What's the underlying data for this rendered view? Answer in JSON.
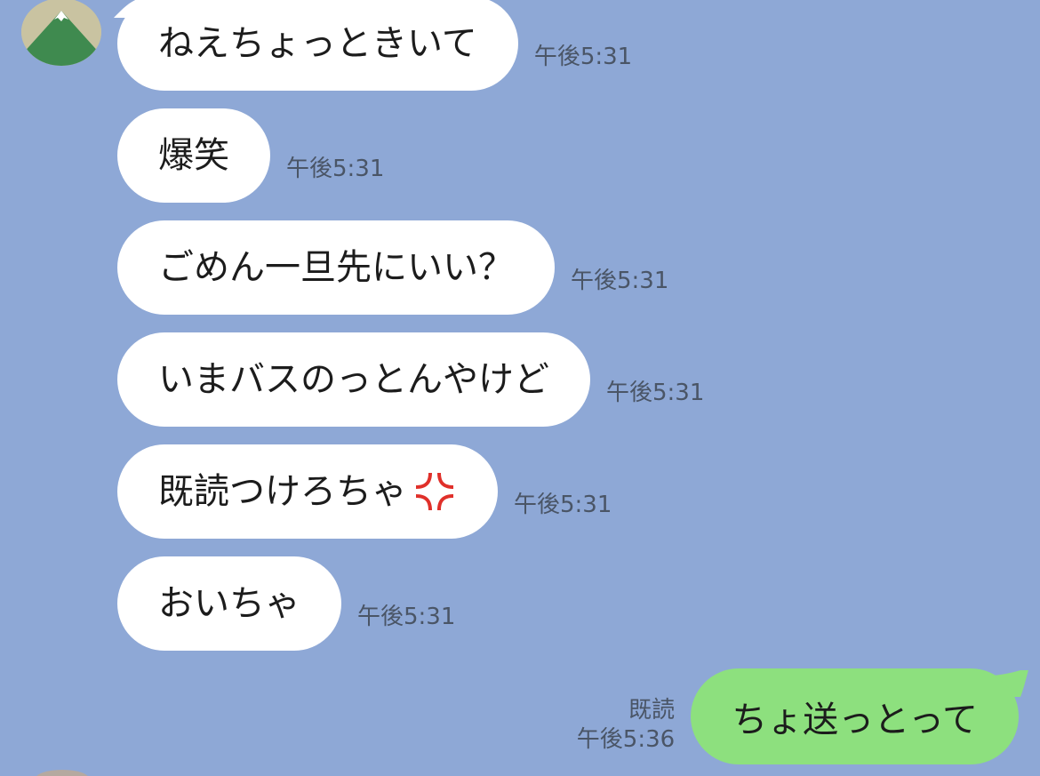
{
  "contact": {
    "avatar_icon": "mountain-avatar-icon"
  },
  "messages": [
    {
      "text": "ねえちょっときいて",
      "time": "午後5:31"
    },
    {
      "text": "爆笑",
      "time": "午後5:31"
    },
    {
      "text": "ごめん一旦先にいい？",
      "time": "午後5:31"
    },
    {
      "text": "いまバスのっとんやけど",
      "time": "午後5:31"
    },
    {
      "text": "既読つけろちゃ",
      "emoji": "anger-symbol-icon",
      "time": "午後5:31"
    },
    {
      "text": "おいちゃ",
      "time": "午後5:31"
    }
  ],
  "outgoing": {
    "text": "ちょ送っとって",
    "read_label": "既読",
    "time": "午後5:36"
  },
  "colors": {
    "background": "#8ea8d6",
    "incoming_bubble": "#ffffff",
    "outgoing_bubble": "#8de07e",
    "timestamp": "#4a5566"
  }
}
